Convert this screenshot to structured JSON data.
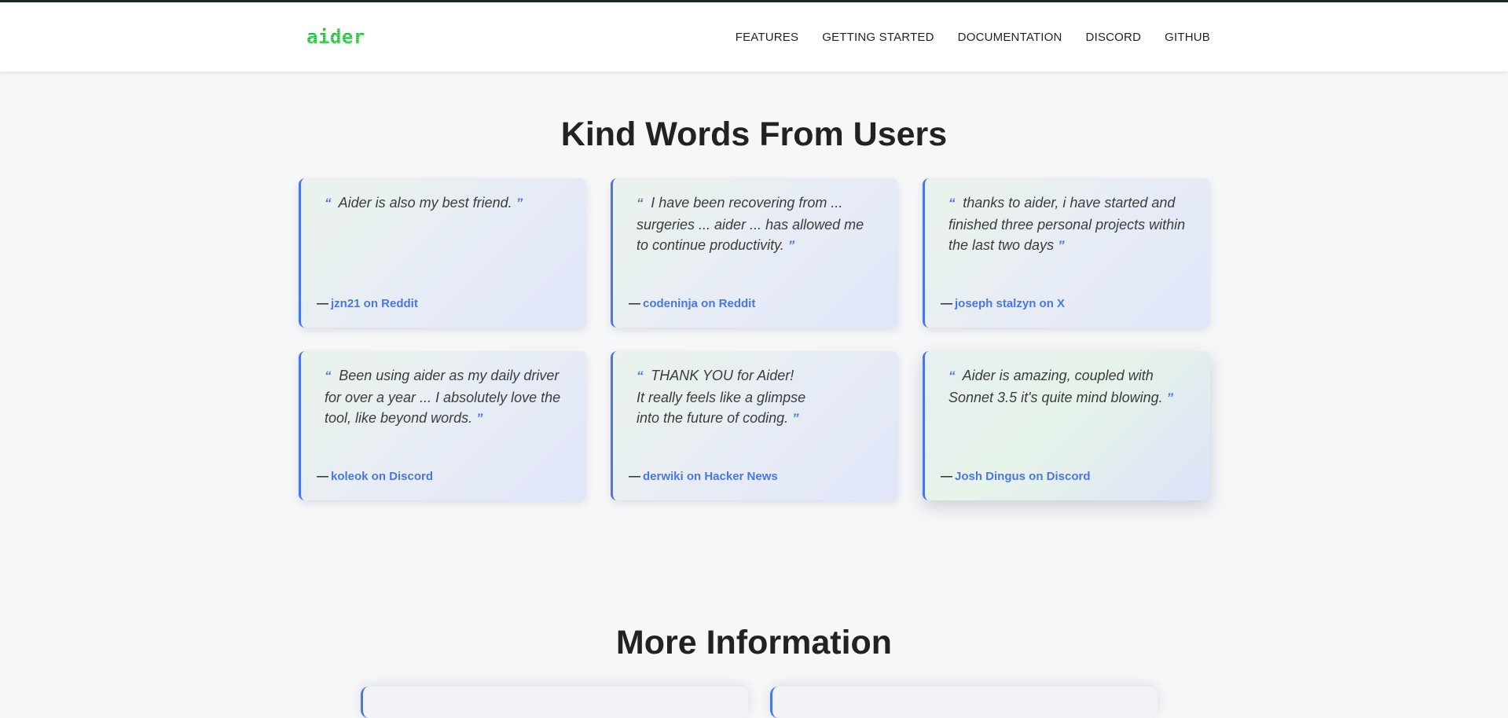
{
  "header": {
    "logo": "aider",
    "nav": [
      "FEATURES",
      "GETTING STARTED",
      "DOCUMENTATION",
      "DISCORD",
      "GITHUB"
    ]
  },
  "testimonials": {
    "title": "Kind Words From Users",
    "items": [
      {
        "quote": "Aider is also my best friend.",
        "author": "jzn21 on Reddit"
      },
      {
        "quote": "I have been recovering from ... surgeries ... aider ... has allowed me to continue productivity.",
        "author": "codeninja on Reddit"
      },
      {
        "quote": "thanks to aider, i have started and finished three personal projects within the last two days",
        "author": "joseph stalzyn on X"
      },
      {
        "quote": "Been using aider as my daily driver for over a year ... I absolutely love the tool, like beyond words.",
        "author": "koleok on Discord"
      },
      {
        "quote": "THANK YOU for Aider!\nIt really feels like a glimpse\ninto the future of coding.",
        "author": "derwiki on Hacker News"
      },
      {
        "quote": "Aider is amazing, coupled with Sonnet 3.5 it's quite mind blowing.",
        "author": "Josh Dingus on Discord"
      }
    ]
  },
  "more_info": {
    "title": "More Information"
  },
  "colors": {
    "accent": "#4a76e8",
    "logo": "#1fbf3a",
    "background": "#f6f7f9"
  }
}
